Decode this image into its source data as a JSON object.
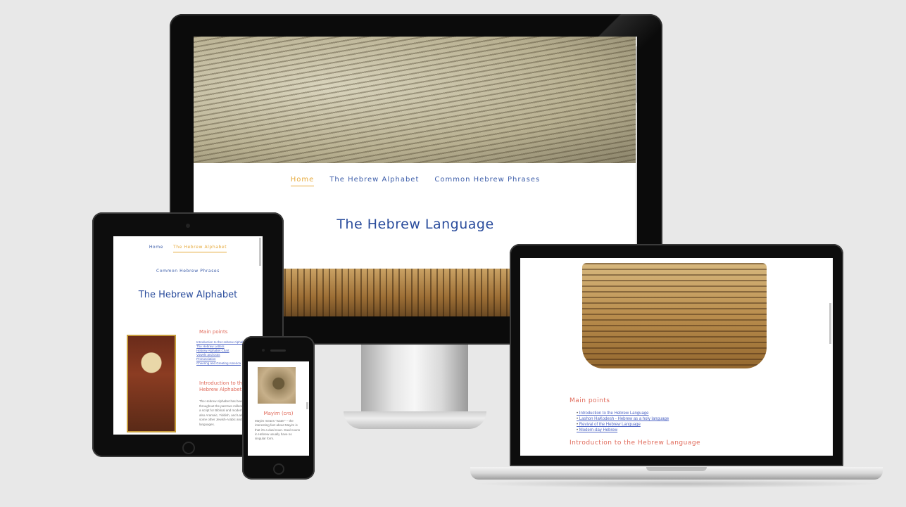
{
  "desktop": {
    "nav": [
      {
        "label": "Home",
        "active": true
      },
      {
        "label": "The Hebrew Alphabet",
        "active": false
      },
      {
        "label": "Common Hebrew Phrases",
        "active": false
      }
    ],
    "title": "The Hebrew Language"
  },
  "tablet": {
    "nav_row1": [
      {
        "label": "Home",
        "active": false
      },
      {
        "label": "The Hebrew Alphabet",
        "active": true
      }
    ],
    "nav_row2": "Common Hebrew Phrases",
    "title": "The Hebrew Alphabet",
    "main_points_heading": "Main points",
    "main_points": [
      "Introduction to the Hebrew Alphabet",
      "The Hebrew Letters",
      "Hebrew Alphabet Chart",
      "Vowels and Dots",
      "Pronunciation",
      "Cheering and Greeting America"
    ],
    "intro_heading": "Introduction to the Hebrew Alphabet",
    "intro_text": "The Hebrew Alphabet has been used throughout the past two millennia mainly as a script for Biblical and modern Hebrew, but also Aramaic, Yiddish, and Ladino, and also some other Jewish-Arabic and Judeo languages."
  },
  "phone": {
    "title": "Mayim (מים)",
    "text": "Mayim means \"water\" – the interesting fact about Mayim is that it's a dual noun. Dual nouns in Hebrew usually have no singular form."
  },
  "laptop": {
    "main_points_heading": "Main points",
    "main_points": [
      "Introduction to the Hebrew Language",
      "Lashon HaKodesh - Hebrew as a holy language",
      "Revival of the Hebrew Language",
      "Modern-day Hebrew"
    ],
    "intro_heading": "Introduction to the Hebrew Language"
  },
  "colors": {
    "background": "#e8e8e8",
    "nav_link": "#3a5ba8",
    "nav_active": "#e6a93a",
    "title": "#2a4c9c",
    "subheading": "#e06a5a",
    "link": "#4f66c5"
  }
}
